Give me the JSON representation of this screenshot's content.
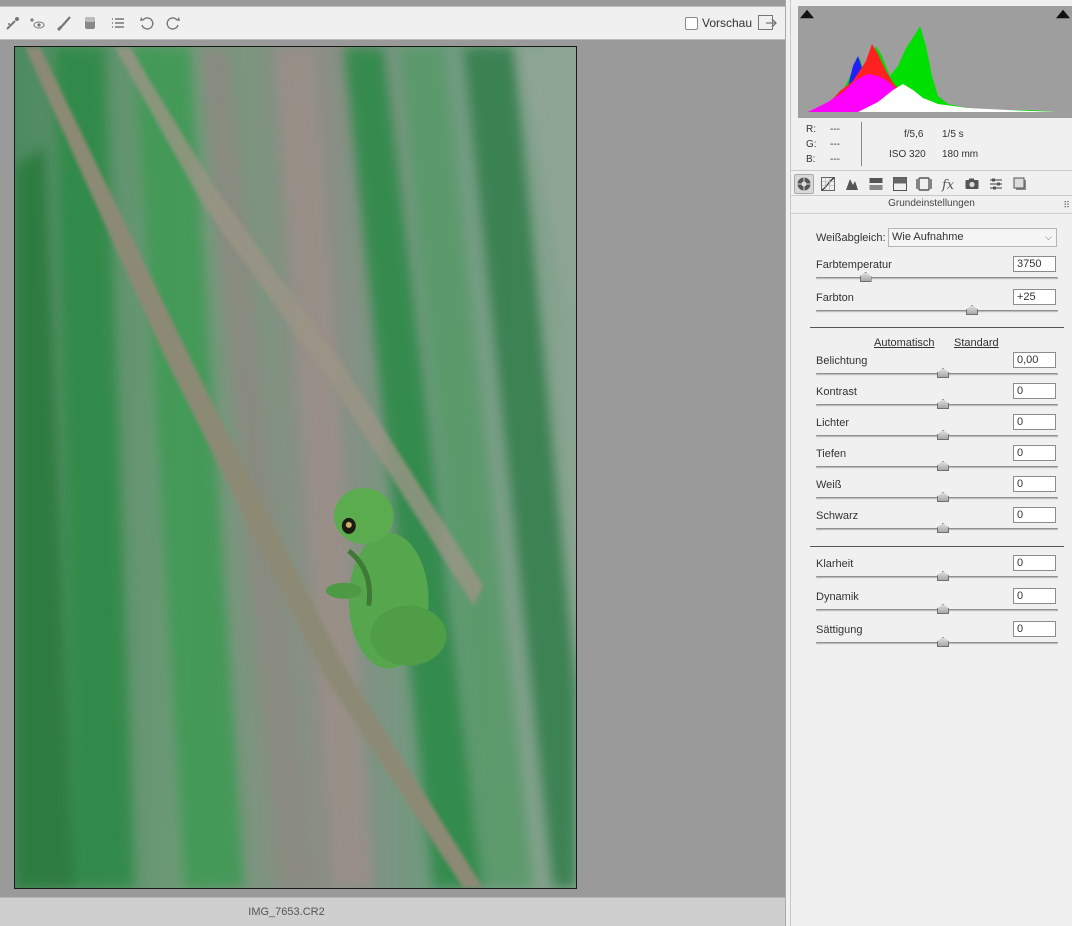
{
  "toolbar": {
    "tools": [
      "color-sampler-icon",
      "red-eye-icon",
      "adjustment-brush-icon",
      "graduated-filter-icon",
      "list-icon",
      "rotate-left-icon",
      "rotate-right-icon"
    ],
    "preview_label": "Vorschau",
    "preview_checked": false
  },
  "status": {
    "filename": "IMG_7653.CR2"
  },
  "info": {
    "r_label": "R:",
    "r_value": "---",
    "g_label": "G:",
    "g_value": "---",
    "b_label": "B:",
    "b_value": "---",
    "aperture": "f/5,6",
    "shutter": "1/5 s",
    "iso": "ISO 320",
    "focal": "180 mm"
  },
  "panel": {
    "tabs": [
      "basic-icon",
      "tone-curve-icon",
      "detail-icon",
      "hsl-icon",
      "split-toning-icon",
      "lens-icon",
      "effects-icon",
      "camera-calibration-icon",
      "presets-icon",
      "snapshots-icon"
    ],
    "title": "Grundeinstellungen",
    "white_balance_label": "Weißabgleich:",
    "white_balance_value": "Wie Aufnahme",
    "auto_label": "Automatisch",
    "default_label": "Standard",
    "sliders": {
      "temperature": {
        "label": "Farbtemperatur",
        "value": "3750",
        "position": 0.18
      },
      "tint": {
        "label": "Farbton",
        "value": "+25",
        "position": 0.62
      },
      "exposure": {
        "label": "Belichtung",
        "value": "0,00",
        "position": 0.5
      },
      "contrast": {
        "label": "Kontrast",
        "value": "0",
        "position": 0.5
      },
      "highlights": {
        "label": "Lichter",
        "value": "0",
        "position": 0.5
      },
      "shadows": {
        "label": "Tiefen",
        "value": "0",
        "position": 0.5
      },
      "whites": {
        "label": "Weiß",
        "value": "0",
        "position": 0.5
      },
      "blacks": {
        "label": "Schwarz",
        "value": "0",
        "position": 0.5
      },
      "clarity": {
        "label": "Klarheit",
        "value": "0",
        "position": 0.5
      },
      "vibrance": {
        "label": "Dynamik",
        "value": "0",
        "position": 0.5
      },
      "saturation": {
        "label": "Sättigung",
        "value": "0",
        "position": 0.5
      }
    }
  },
  "colors": {
    "canvas_bg": "#9a9a9a",
    "panel_bg": "#f0f0f0",
    "histogram_bg": "#9e9e9e"
  }
}
